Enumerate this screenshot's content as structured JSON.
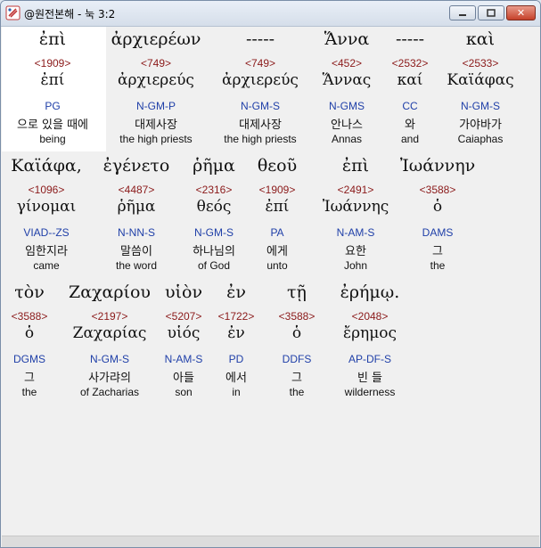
{
  "window": {
    "title": "@원전본해 - 눅 3:2",
    "min_label": "",
    "max_label": "",
    "close_label": "✕"
  },
  "rows": [
    {
      "words": [
        {
          "greek": "ἐπὶ",
          "strong": "<1909>",
          "lemma": "ἐπί",
          "parse": "PG",
          "korean": "으로 있을 때에",
          "english": "being"
        },
        {
          "greek": "ἀρχιερέων",
          "strong": "<749>",
          "lemma": "ἀρχιερεύς",
          "parse": "N-GM-P",
          "korean": "대제사장",
          "english": "the high priests"
        },
        {
          "greek": "-----",
          "strong": "<749>",
          "lemma": "ἀρχιερεύς",
          "parse": "N-GM-S",
          "korean": "대제사장",
          "english": "the high priests"
        },
        {
          "greek": "Ἅννα",
          "strong": "<452>",
          "lemma": "Ἅννας",
          "parse": "N-GMS",
          "korean": "안나스",
          "english": "Annas"
        },
        {
          "greek": "-----",
          "strong": "<2532>",
          "lemma": "καί",
          "parse": "CC",
          "korean": "와",
          "english": "and"
        },
        {
          "greek": "καὶ",
          "strong": "<2533>",
          "lemma": "Καϊάφας",
          "parse": "N-GM-S",
          "korean": "가야바가",
          "english": "Caiaphas"
        }
      ]
    },
    {
      "words": [
        {
          "greek": "Καϊάφα,",
          "strong": "<1096>",
          "lemma": "γίνομαι",
          "parse": "VIAD--ZS",
          "korean": "임한지라",
          "english": "came"
        },
        {
          "greek": "ἐγένετο",
          "strong": "<4487>",
          "lemma": "ῥῆμα",
          "parse": "N-NN-S",
          "korean": "말씀이",
          "english": "the word"
        },
        {
          "greek": "ῥῆμα",
          "strong": "<2316>",
          "lemma": "θεός",
          "parse": "N-GM-S",
          "korean": "하나님의",
          "english": "of God"
        },
        {
          "greek": "θεοῦ",
          "strong": "<1909>",
          "lemma": "ἐπί",
          "parse": "PA",
          "korean": "에게",
          "english": "unto"
        },
        {
          "greek": "ἐπὶ",
          "strong": "<2491>",
          "lemma": "Ἰωάννης",
          "parse": "N-AM-S",
          "korean": "요한",
          "english": "John"
        },
        {
          "greek": "Ἰωάννην",
          "strong": "<3588>",
          "lemma": "ὁ",
          "parse": "DAMS",
          "korean": "그",
          "english": "the"
        }
      ]
    },
    {
      "words": [
        {
          "greek": "τὸν",
          "strong": "<3588>",
          "lemma": "ὁ",
          "parse": "DGMS",
          "korean": "그",
          "english": "the"
        },
        {
          "greek": "Ζαχαρίου",
          "strong": "<2197>",
          "lemma": "Ζαχαρίας",
          "parse": "N-GM-S",
          "korean": "사가랴의",
          "english": "of Zacharias"
        },
        {
          "greek": "υἱὸν",
          "strong": "<5207>",
          "lemma": "υἱός",
          "parse": "N-AM-S",
          "korean": "아들",
          "english": "son"
        },
        {
          "greek": "ἐν",
          "strong": "<1722>",
          "lemma": "ἐν",
          "parse": "PD",
          "korean": "에서",
          "english": "in"
        },
        {
          "greek": "τῇ",
          "strong": "<3588>",
          "lemma": "ὁ",
          "parse": "DDFS",
          "korean": "그",
          "english": "the"
        },
        {
          "greek": "ἐρήμῳ.",
          "strong": "<2048>",
          "lemma": "ἔρημος",
          "parse": "AP-DF-S",
          "korean": "빈 들",
          "english": "wilderness"
        }
      ]
    }
  ]
}
